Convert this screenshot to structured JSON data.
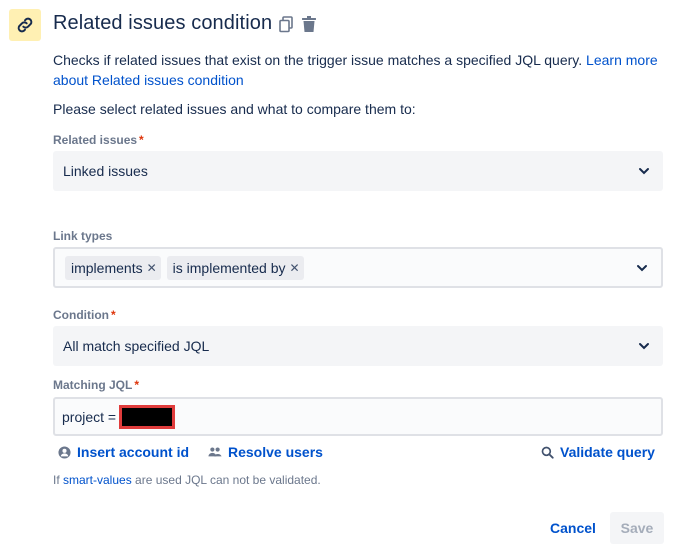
{
  "header": {
    "title": "Related issues condition",
    "icon": "link-icon",
    "accent": "#fff0b3"
  },
  "description": {
    "text": "Checks if related issues that exist on the trigger issue matches a specified JQL query.",
    "link_line1": "Learn more",
    "link_line2": "about Related issues condition"
  },
  "prompt": "Please select related issues and what to compare them to:",
  "related_issues": {
    "label": "Related issues",
    "required": "*",
    "value": "Linked issues"
  },
  "link_types": {
    "label": "Link types",
    "tags": [
      "implements",
      "is implemented by"
    ]
  },
  "condition": {
    "label": "Condition",
    "required": "*",
    "value": "All match specified JQL"
  },
  "matching_jql": {
    "label": "Matching JQL",
    "required": "*",
    "value": "project ="
  },
  "actions": {
    "insert_account": "Insert account id",
    "resolve_users": "Resolve users",
    "validate_query": "Validate query"
  },
  "hint": {
    "prefix": "If",
    "link": "smart-values",
    "suffix": "are used JQL can not be validated."
  },
  "footer": {
    "cancel": "Cancel",
    "save": "Save"
  }
}
